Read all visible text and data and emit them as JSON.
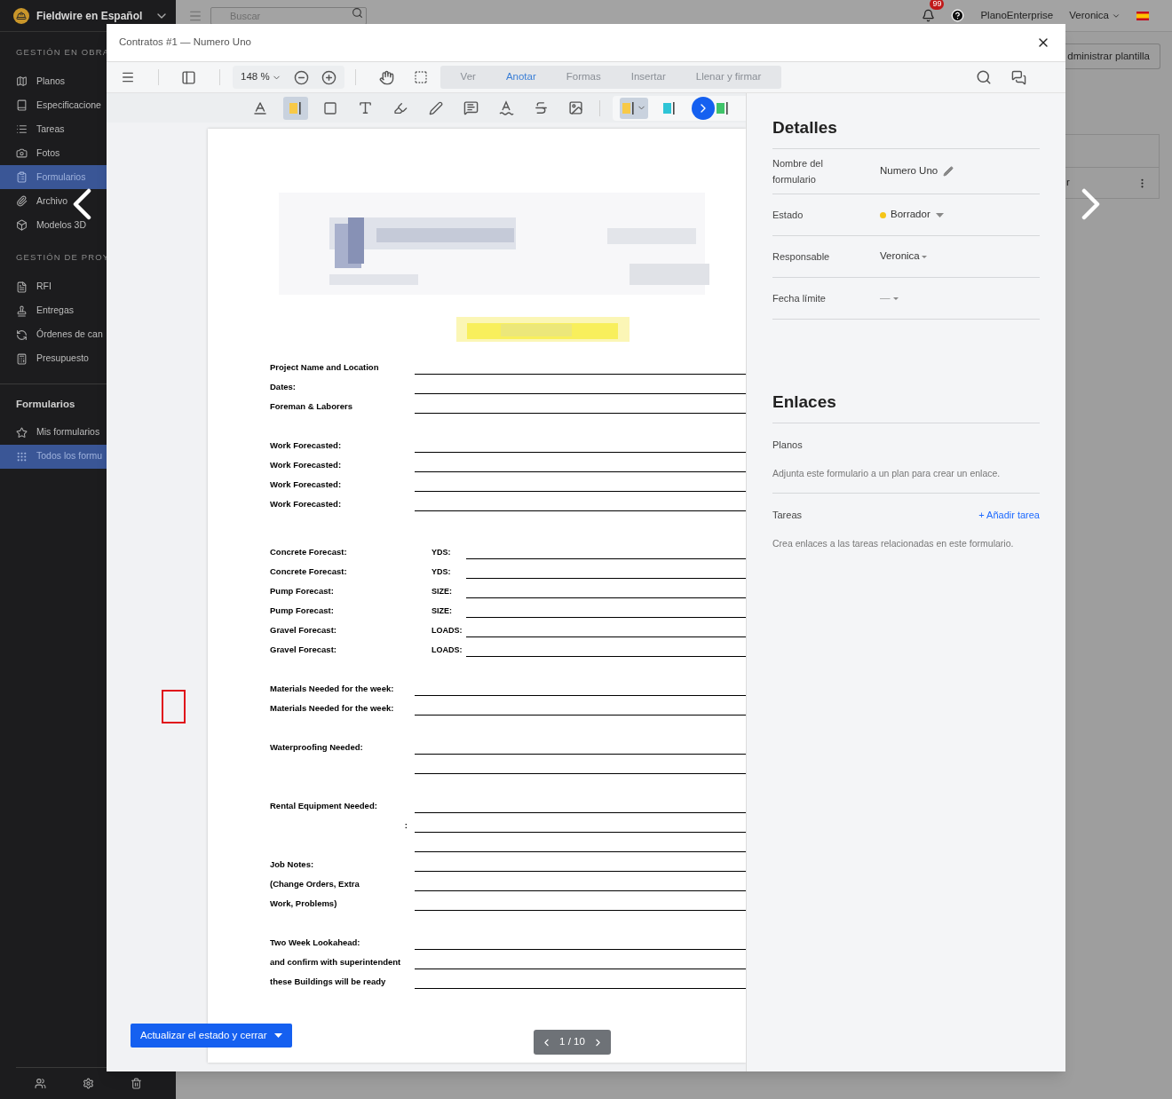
{
  "app": {
    "workspace": "Fieldwire en Español",
    "search": {
      "placeholder": "Buscar"
    },
    "notifications": "99",
    "plan": "PlanoEnterprise",
    "user": "Veronica"
  },
  "sidebar": {
    "sections": [
      {
        "kind": "caps",
        "title": "GESTIÓN EN OBRA",
        "items": [
          {
            "label": "Planos",
            "selected": false
          },
          {
            "label": "Especificacione",
            "selected": false
          },
          {
            "label": "Tareas",
            "selected": false
          },
          {
            "label": "Fotos",
            "selected": false
          },
          {
            "label": "Formularios",
            "selected": true
          },
          {
            "label": "Archivo",
            "selected": false
          },
          {
            "label": "Modelos 3D",
            "selected": false
          }
        ]
      },
      {
        "kind": "caps",
        "title": "GESTIÓN DE PROY",
        "items": [
          {
            "label": "RFI",
            "selected": false
          },
          {
            "label": "Entregas",
            "selected": false
          },
          {
            "label": "Órdenes de can",
            "selected": false
          },
          {
            "label": "Presupuesto",
            "selected": false
          }
        ]
      },
      {
        "kind": "heading",
        "title": "Formularios",
        "items": [
          {
            "label": "Mis formularios",
            "selected": false
          },
          {
            "label": "Todos los formu",
            "selected": true
          }
        ]
      }
    ]
  },
  "background": {
    "button": "dministrar plantilla",
    "row_text": "r"
  },
  "dialog": {
    "title": "Contratos #1 — Numero Uno",
    "zoom": "148 %",
    "tabs": [
      {
        "label": "Ver",
        "selected": false
      },
      {
        "label": "Anotar",
        "selected": true
      },
      {
        "label": "Formas",
        "selected": false
      },
      {
        "label": "Insertar",
        "selected": false
      },
      {
        "label": "Llenar y firmar",
        "selected": false
      }
    ],
    "tools": [
      {
        "selected": false
      },
      {
        "selected": true
      },
      {
        "selected": false
      },
      {
        "selected": false
      },
      {
        "selected": false
      },
      {
        "selected": false
      },
      {
        "selected": false
      },
      {
        "selected": false
      },
      {
        "selected": false
      },
      {
        "selected": false
      }
    ],
    "presets": [
      {
        "selected": true
      },
      {
        "selected": false
      },
      {
        "selected": false
      }
    ]
  },
  "document": {
    "groups": [
      {
        "rows": [
          {
            "kind": "field",
            "label": "Project Name and Location"
          },
          {
            "kind": "field",
            "label": "Dates:"
          },
          {
            "kind": "field",
            "label": "Foreman & Laborers"
          }
        ]
      },
      {
        "rows": [
          {
            "kind": "field",
            "label": "Work Forecasted:"
          },
          {
            "kind": "field",
            "label": "Work Forecasted:"
          },
          {
            "kind": "field",
            "label": "Work Forecasted:"
          },
          {
            "kind": "field",
            "label": "Work Forecasted:"
          }
        ]
      },
      {
        "rows": [
          {
            "kind": "unit",
            "label": "Concrete Forecast:",
            "unit": "YDS:"
          },
          {
            "kind": "unit",
            "label": "Concrete Forecast:",
            "unit": "YDS:"
          },
          {
            "kind": "unit",
            "label": "Pump Forecast:",
            "unit": "SIZE:"
          },
          {
            "kind": "unit",
            "label": "Pump Forecast:",
            "unit": "SIZE:"
          },
          {
            "kind": "unit",
            "label": "Gravel Forecast:",
            "unit": "LOADS:"
          },
          {
            "kind": "unit",
            "label": "Gravel Forecast:",
            "unit": "LOADS:"
          }
        ]
      },
      {
        "rows": [
          {
            "kind": "field",
            "label": "Materials Needed for the week:"
          },
          {
            "kind": "field",
            "label": "Materials Needed for the week:"
          }
        ]
      },
      {
        "rows": [
          {
            "kind": "field",
            "label": "Waterproofing Needed:"
          },
          {
            "kind": "line"
          }
        ]
      },
      {
        "rows": [
          {
            "kind": "field",
            "label": "Rental Equipment Needed:"
          },
          {
            "kind": "redacted",
            "label": ":"
          },
          {
            "kind": "line"
          },
          {
            "kind": "field",
            "label": "Job Notes:"
          },
          {
            "kind": "field",
            "label": "(Change Orders, Extra"
          },
          {
            "kind": "field",
            "label": "Work, Problems)"
          }
        ]
      },
      {
        "rows": [
          {
            "kind": "field",
            "label": "Two Week Lookahead:"
          },
          {
            "kind": "field",
            "label": "and confirm with superintendent"
          },
          {
            "kind": "field",
            "label": "these Buildings  will be ready"
          }
        ]
      }
    ]
  },
  "details": {
    "title": "Detalles",
    "fields": [
      {
        "kind": "editable",
        "label": "Nombre del formulario",
        "value": "Numero Uno"
      },
      {
        "kind": "status",
        "label": "Estado",
        "value": "Borrador",
        "color": "#f5c518"
      },
      {
        "kind": "dropdown",
        "label": "Responsable",
        "value": "Veronica"
      },
      {
        "kind": "empty",
        "label": "Fecha límite",
        "value": "—"
      }
    ]
  },
  "links": {
    "title": "Enlaces",
    "sections": [
      {
        "label": "Planos",
        "hint": "Adjunta este formulario a un plan para crear un enlace."
      },
      {
        "label": "Tareas",
        "action": "+ Añadir tarea",
        "hint": "Crea enlaces a las tareas relacionadas en este formulario."
      }
    ]
  },
  "footer": {
    "primary_button": "Actualizar el estado y cerrar",
    "page": "1 / 10"
  }
}
